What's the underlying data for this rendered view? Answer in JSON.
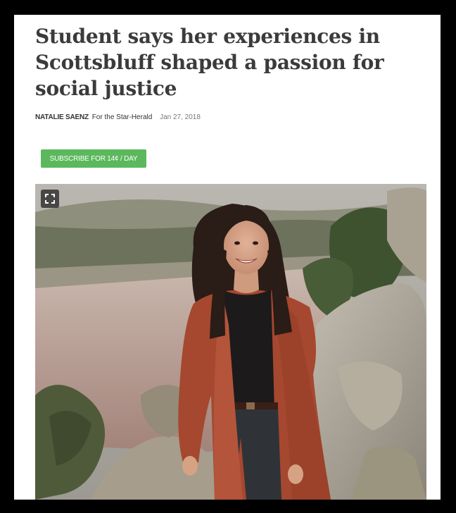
{
  "article": {
    "headline": "Student says her experiences in Scottsbluff shaped a passion for social justice",
    "author": "NATALIE SAENZ",
    "organization": "For the Star-Herald",
    "date": "Jan 27, 2018"
  },
  "subscribe": {
    "label": "SUBSCRIBE FOR 14¢ / DAY"
  },
  "photo": {
    "expand_icon": "expand-icon"
  },
  "colors": {
    "subscribe_bg": "#5cb85c",
    "headline": "#3b3b3b",
    "frame": "#000000"
  }
}
